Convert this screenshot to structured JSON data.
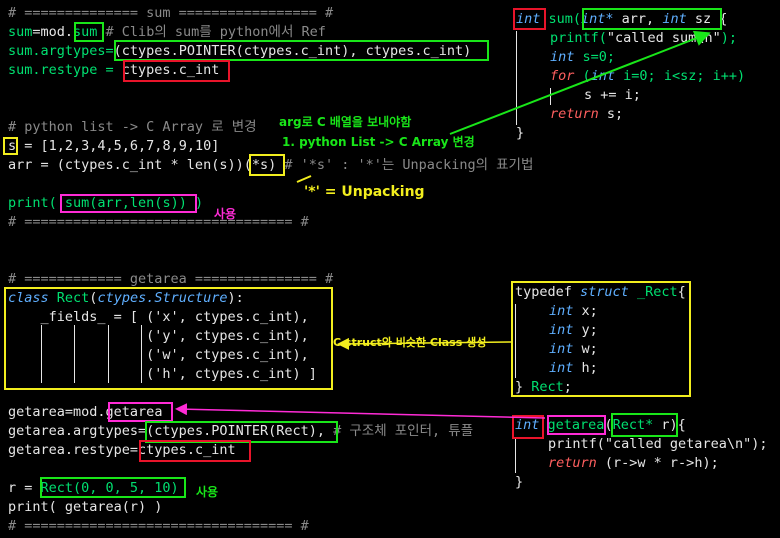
{
  "left": {
    "l1": "# ============== sum ================= #",
    "l2a": "sum",
    "l2b": "=mod.",
    "l2c": "sum",
    "l2d": " # Clib의 sum를 python에서 Ref",
    "l3a": "sum.argtypes=",
    "l3b": "(ctypes.POINTER(ctypes.c_int), ctypes.c_int)",
    "l4a": "sum.restype = ",
    "l4b": "ctypes.c_int",
    "l5": "# python list -> C Array 로 변경",
    "l6a": "s",
    "l6b": " = [1,2,3,4,5,6,7,8,9,10]",
    "l7a": "arr = (ctypes.c_int * len(s))",
    "l7b": "(*s)",
    "l7c": " # '*s' : '*'는 Unpacking의 표기법",
    "l8a": "print( ",
    "l8b": "sum(arr,len(s))",
    "l8c": " )",
    "l9": "# ================================= #",
    "l10": "# ============ getarea =============== #",
    "l11a": "class ",
    "l11b": "Rect",
    "l11c": "(",
    "l11d": "ctypes.Structure",
    "l11e": "):",
    "l12": "    _fields_ = [ ('x', ctypes.c_int),",
    "l13": "                 ('y', ctypes.c_int),",
    "l14": "                 ('w', ctypes.c_int),",
    "l15": "                 ('h', ctypes.c_int) ]",
    "l16a": "getarea=mod.",
    "l16b": "getarea",
    "l17a": "getarea.argtypes=",
    "l17b": "(ctypes.POINTER(Rect),",
    "l17c": " # 구조체 포인터, 튜플",
    "l18a": "getarea.restype=",
    "l18b": "ctypes.c_int",
    "l19a": "r = ",
    "l19b": "Rect(0, 0, 5, 10)",
    "l20": "print( getarea(r) )",
    "l21": "# ================================= #"
  },
  "right_top": {
    "t1a": "int",
    "t1b": " sum(",
    "t1c": "int*",
    "t1d": " arr, ",
    "t1e": "int",
    "t1f": " sz",
    "t1g": " {",
    "t2a": "printf(",
    "t2b": "\"called sum\\n\"",
    "t2c": ");",
    "t3a": "int",
    "t3b": " s=0;",
    "t4a": "for",
    "t4b": " (",
    "t4c": "int",
    "t4d": " i=0; i<sz; i++)",
    "t5": "s += i;",
    "t6a": "return",
    "t6b": " s;",
    "t7": "}"
  },
  "struct": {
    "s1a": "typedef ",
    "s1b": "struct",
    "s1c": " _Rect",
    "s1d": "{",
    "s2a": "int",
    "s2b": " x;",
    "s3a": "int",
    "s3b": " y;",
    "s4a": "int",
    "s4b": " w;",
    "s5a": "int",
    "s5b": " h;",
    "s6a": "} ",
    "s6b": "Rect",
    "s6c": ";"
  },
  "right_bottom": {
    "g1a": "int",
    "g1b": " ",
    "g1c": "getarea",
    "g1d": "(",
    "g1e": "Rect*",
    "g1f": " r",
    "g1g": "){",
    "g2a": "printf(",
    "g2b": "\"called getarea\\n\"",
    "g2c": ");",
    "g3a": "return",
    "g3b": " (r->w * r->h);",
    "g4": "}"
  },
  "annotations": {
    "arg_title": "arg로 C 배열을 보내야함",
    "arg_sub": "1. python List -> C Array 변경",
    "unpacking": "'*' = Unpacking",
    "use1": "사용",
    "struct_note": "C struct와 비슷한 Class 생성",
    "use2": "사용"
  },
  "colors": {
    "green": "#19e619",
    "pink": "#ff2bd6",
    "red": "#e8142a",
    "yellow": "#f2ee1e",
    "comment": "#8a8a8a",
    "keyword": "#5fafff"
  }
}
